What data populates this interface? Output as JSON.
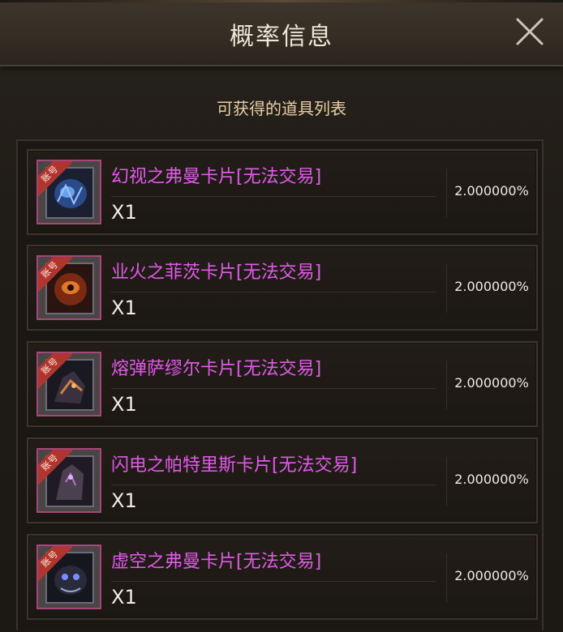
{
  "window": {
    "title": "概率信息",
    "close_icon": "close-icon"
  },
  "list": {
    "heading": "可获得的道具列表",
    "items": [
      {
        "tag": "账号",
        "name": "幻视之弗曼卡片[无法交易]",
        "quantity": "X1",
        "rate": "2.000000%"
      },
      {
        "tag": "账号",
        "name": "业火之菲茨卡片[无法交易]",
        "quantity": "X1",
        "rate": "2.000000%"
      },
      {
        "tag": "账号",
        "name": "熔弹萨缪尔卡片[无法交易]",
        "quantity": "X1",
        "rate": "2.000000%"
      },
      {
        "tag": "账号",
        "name": "闪电之帕特里斯卡片[无法交易]",
        "quantity": "X1",
        "rate": "2.000000%"
      },
      {
        "tag": "账号",
        "name": "虚空之弗曼卡片[无法交易]",
        "quantity": "X1",
        "rate": "2.000000%"
      }
    ]
  },
  "colors": {
    "item_name": "#e25ae9",
    "heading": "#e9cfa4",
    "tag_bg": "#b1352f",
    "card_border": "#a6467a"
  }
}
